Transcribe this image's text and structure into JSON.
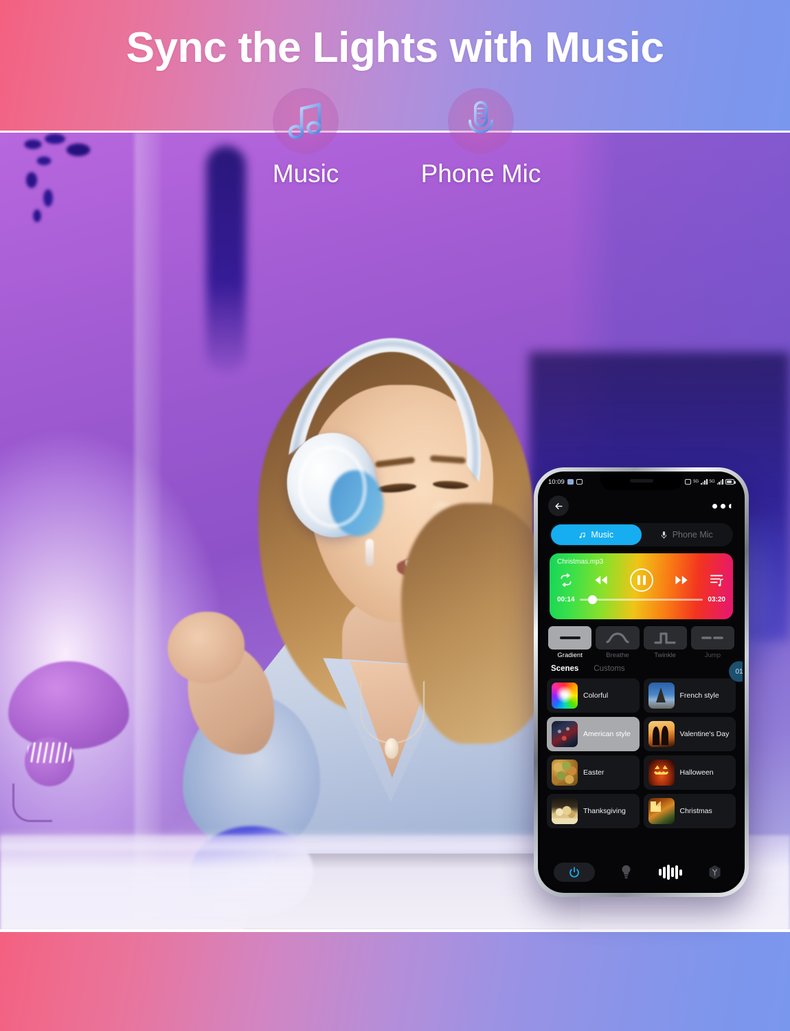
{
  "header": {
    "title": "Sync the Lights with Music",
    "modes": [
      {
        "label": "Music",
        "icon": "music-note-icon"
      },
      {
        "label": "Phone Mic",
        "icon": "microphone-icon"
      }
    ],
    "gradient": {
      "from": "#f4607f",
      "mid": "#b58ed9",
      "to": "#7a97ee"
    }
  },
  "phone": {
    "statusbar": {
      "time": "10:09",
      "icons": [
        "alarm-icon",
        "screenshot-icon"
      ],
      "right_icons": [
        "vibrate-icon",
        "signal-5g-1",
        "signal-5g-2",
        "battery-icon"
      ],
      "network_label": "5G"
    },
    "nav": {
      "back": "back-arrow-icon",
      "more": "more-dots-icon"
    },
    "source_toggle": {
      "options": [
        {
          "label": "Music",
          "icon": "music-note-icon",
          "active": true
        },
        {
          "label": "Phone Mic",
          "icon": "microphone-icon",
          "active": false
        }
      ]
    },
    "player": {
      "track": "Christmas.mp3",
      "elapsed": "00:14",
      "duration": "03:20",
      "progress_percent": 7,
      "state": "playing",
      "controls": [
        "repeat-icon",
        "rewind-icon",
        "pause-icon",
        "fast-forward-icon",
        "playlist-icon"
      ]
    },
    "effects": {
      "items": [
        {
          "label": "Gradient",
          "icon": "line-flat-icon",
          "selected": true
        },
        {
          "label": "Breathe",
          "icon": "wave-arc-icon",
          "selected": false
        },
        {
          "label": "Twinkle",
          "icon": "square-pulse-icon",
          "selected": false
        },
        {
          "label": "Jump",
          "icon": "dashed-line-icon",
          "selected": false
        }
      ]
    },
    "tabs": [
      {
        "label": "Scenes",
        "active": true
      },
      {
        "label": "Customs",
        "active": false
      }
    ],
    "count_badge": "01",
    "scenes": [
      {
        "name": "Colorful",
        "thumb": "rainbow-burst-thumb",
        "selected": false
      },
      {
        "name": "French style",
        "thumb": "eiffel-tower-thumb",
        "selected": false
      },
      {
        "name": "American style",
        "thumb": "city-night-thumb",
        "selected": true
      },
      {
        "name": "Valentine's Day",
        "thumb": "couple-sunset-thumb",
        "selected": false
      },
      {
        "name": "Easter",
        "thumb": "easter-eggs-thumb",
        "selected": false
      },
      {
        "name": "Halloween",
        "thumb": "jack-o-lantern-thumb",
        "selected": false
      },
      {
        "name": "Thanksgiving",
        "thumb": "thanksgiving-table-thumb",
        "selected": false
      },
      {
        "name": "Christmas",
        "thumb": "christmas-tree-thumb",
        "selected": false
      }
    ],
    "bottom_nav": [
      {
        "icon": "power-icon",
        "active": true
      },
      {
        "icon": "bulb-icon",
        "active": false
      },
      {
        "icon": "equalizer-icon",
        "active": true
      },
      {
        "icon": "scene-hex-icon",
        "active": false
      }
    ],
    "accent_color": "#16AEF0"
  }
}
